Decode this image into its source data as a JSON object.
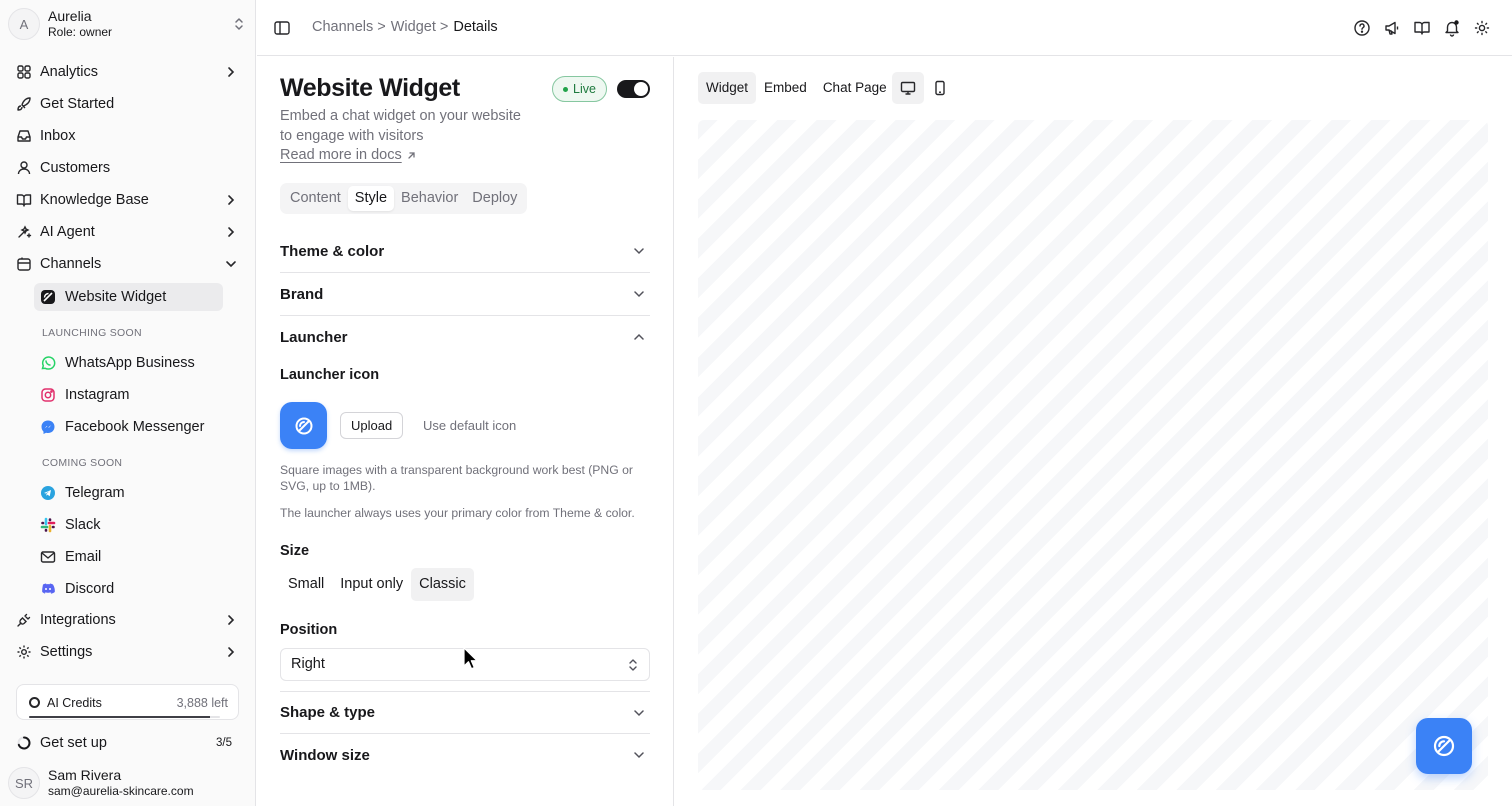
{
  "org": {
    "initial": "A",
    "name": "Aurelia",
    "role": "Role: owner"
  },
  "nav": {
    "analytics": "Analytics",
    "get_started": "Get Started",
    "inbox": "Inbox",
    "customers": "Customers",
    "knowledge_base": "Knowledge Base",
    "ai_agent": "AI Agent",
    "channels": "Channels",
    "website_widget": "Website Widget",
    "launching_soon": "LAUNCHING SOON",
    "whatsapp": "WhatsApp Business",
    "instagram": "Instagram",
    "facebook": "Facebook Messenger",
    "coming_soon": "COMING SOON",
    "telegram": "Telegram",
    "slack": "Slack",
    "email": "Email",
    "discord": "Discord",
    "integrations": "Integrations",
    "settings": "Settings"
  },
  "credits": {
    "label": "AI Credits",
    "left": "3,888 left",
    "fill": 0.95
  },
  "setup": {
    "label": "Get set up",
    "count": "3/5"
  },
  "user": {
    "initials": "SR",
    "name": "Sam Rivera",
    "email": "sam@aurelia-skincare.com"
  },
  "breadcrumb": {
    "channels": "Channels",
    "widget": "Widget",
    "current": "Details",
    "sep": ">"
  },
  "widget": {
    "title": "Website Widget",
    "status": "Live",
    "enabled": true,
    "description": "Embed a chat widget on your website to engage with visitors",
    "docs_link": "Read more in docs"
  },
  "tabs": [
    "Content",
    "Style",
    "Behavior",
    "Deploy"
  ],
  "active_tab": "Style",
  "sections": {
    "theme": "Theme & color",
    "brand": "Brand",
    "launcher": "Launcher",
    "shape": "Shape & type",
    "window": "Window size"
  },
  "launcher": {
    "icon_label": "Launcher icon",
    "upload": "Upload",
    "use_default": "Use default icon",
    "help1": "Square images with a transparent background work best (PNG or SVG, up to 1MB).",
    "help2": "The launcher always uses your primary color from Theme & color.",
    "size_label": "Size",
    "sizes": [
      "Small",
      "Input only",
      "Classic"
    ],
    "size_selected": "Classic",
    "position_label": "Position",
    "position_value": "Right"
  },
  "preview": {
    "tabs": [
      "Widget",
      "Embed",
      "Chat Page"
    ],
    "active": "Widget",
    "device": "desktop"
  },
  "colors": {
    "accent": "#3b82f6",
    "live_green": "#22a34a"
  }
}
